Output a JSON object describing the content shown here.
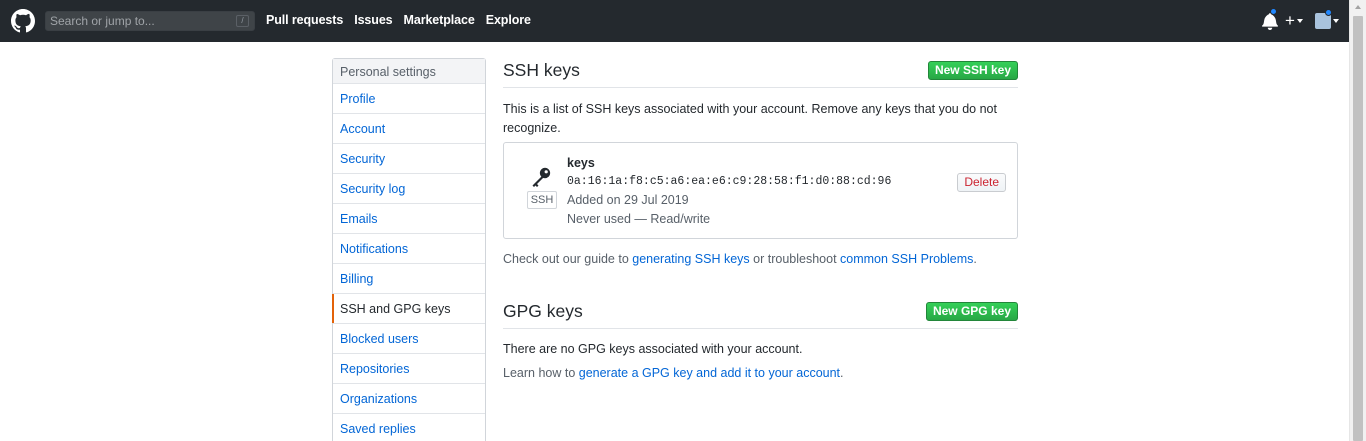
{
  "header": {
    "search_placeholder": "Search or jump to...",
    "search_shortcut": "/",
    "nav": [
      "Pull requests",
      "Issues",
      "Marketplace",
      "Explore"
    ],
    "plus_label": "+"
  },
  "sidebar": {
    "header": "Personal settings",
    "items": [
      {
        "label": "Profile"
      },
      {
        "label": "Account"
      },
      {
        "label": "Security"
      },
      {
        "label": "Security log"
      },
      {
        "label": "Emails"
      },
      {
        "label": "Notifications"
      },
      {
        "label": "Billing"
      },
      {
        "label": "SSH and GPG keys",
        "selected": true
      },
      {
        "label": "Blocked users"
      },
      {
        "label": "Repositories"
      },
      {
        "label": "Organizations"
      },
      {
        "label": "Saved replies"
      }
    ]
  },
  "ssh": {
    "title": "SSH keys",
    "new_button": "New SSH key",
    "intro": "This is a list of SSH keys associated with your account. Remove any keys that you do not recognize.",
    "key": {
      "badge": "SSH",
      "title": "keys",
      "fingerprint": "0a:16:1a:f8:c5:a6:ea:e6:c9:28:58:f1:d0:88:cd:96",
      "added": "Added on 29 Jul 2019",
      "usage": "Never used — Read/write",
      "delete_label": "Delete"
    },
    "guide": {
      "prefix": "Check out our guide to ",
      "link1": "generating SSH keys",
      "middle": " or troubleshoot ",
      "link2": "common SSH Problems",
      "suffix": "."
    }
  },
  "gpg": {
    "title": "GPG keys",
    "new_button": "New GPG key",
    "none_text": "There are no GPG keys associated with your account.",
    "learn_prefix": "Learn how to ",
    "learn_link": "generate a GPG key and add it to your account",
    "learn_suffix": "."
  },
  "icons": {
    "logo": "github-logo-icon",
    "bell": "bell-icon",
    "key": "key-icon"
  },
  "colors": {
    "header_bg": "#24292e",
    "link": "#0366d6",
    "green": "#28a745",
    "danger": "#cb2431",
    "selected_marker": "#e36209"
  }
}
